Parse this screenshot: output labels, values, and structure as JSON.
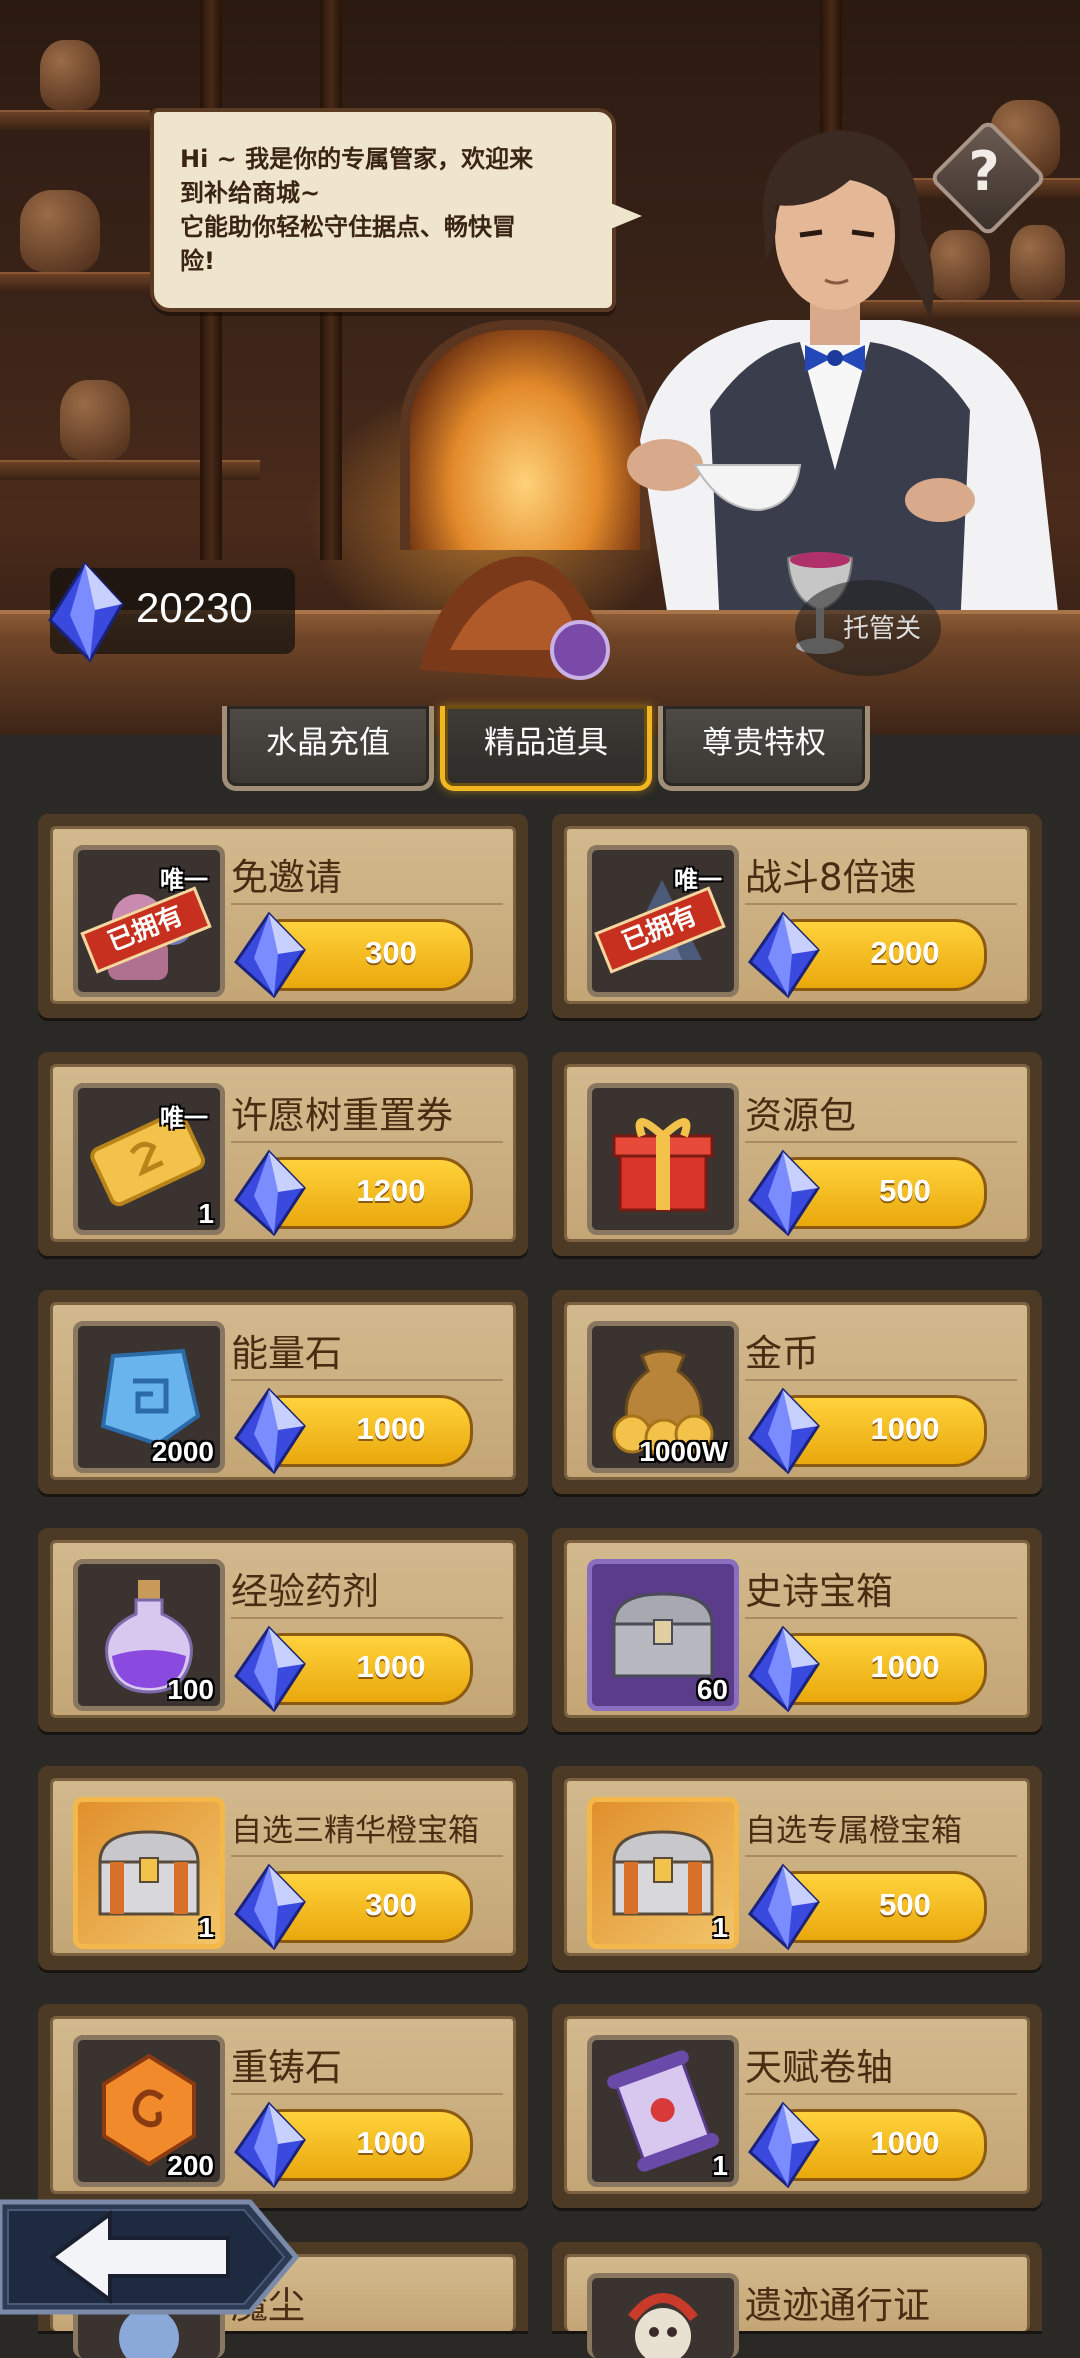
{
  "header": {
    "speech_lines": [
      "Hi ~ 我是你的专属管家，欢迎来",
      "到补给商城~",
      "它能助你轻松守住据点、畅快冒",
      "险!"
    ],
    "help_symbol": "?",
    "crystal_balance": "20230",
    "auto_close_label": "托管关"
  },
  "tabs": [
    {
      "label": "水晶充值",
      "active": false
    },
    {
      "label": "精品道具",
      "active": true
    },
    {
      "label": "尊贵特权",
      "active": false
    }
  ],
  "items": [
    {
      "name": "免邀请",
      "price": "300",
      "tag": "唯一",
      "owned_label": "已拥有",
      "icon": "invite-pass-icon"
    },
    {
      "name": "战斗8倍速",
      "price": "2000",
      "tag": "唯一",
      "owned_label": "已拥有",
      "icon": "speed-icon"
    },
    {
      "name": "许愿树重置券",
      "price": "1200",
      "tag": "唯一",
      "qty": "1",
      "icon": "ticket-icon"
    },
    {
      "name": "资源包",
      "price": "500",
      "icon": "gift-box-icon"
    },
    {
      "name": "能量石",
      "price": "1000",
      "qty": "2000",
      "icon": "energy-stone-icon"
    },
    {
      "name": "金币",
      "price": "1000",
      "qty": "1000W",
      "icon": "gold-coin-bag-icon"
    },
    {
      "name": "经验药剂",
      "price": "1000",
      "qty": "100",
      "icon": "exp-potion-icon"
    },
    {
      "name": "史诗宝箱",
      "price": "1000",
      "qty": "60",
      "icon": "epic-chest-icon"
    },
    {
      "name": "自选三精华橙宝箱",
      "price": "300",
      "qty": "1",
      "icon": "orange-chest-icon"
    },
    {
      "name": "自选专属橙宝箱",
      "price": "500",
      "qty": "1",
      "icon": "exclusive-chest-icon"
    },
    {
      "name": "重铸石",
      "price": "1000",
      "qty": "200",
      "icon": "reforge-stone-icon"
    },
    {
      "name": "天赋卷轴",
      "price": "1000",
      "qty": "1",
      "icon": "talent-scroll-icon"
    },
    {
      "name": "魔尘",
      "price": "",
      "icon": "magic-dust-icon"
    },
    {
      "name": "遗迹通行证",
      "price": "",
      "icon": "ruins-pass-icon"
    }
  ],
  "colors": {
    "accent_gold": "#f2b720",
    "price_yellow": "#ffd23c",
    "owned_red": "#c7301f"
  }
}
